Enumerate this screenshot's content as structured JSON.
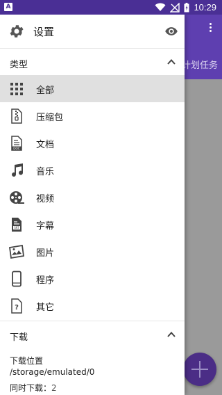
{
  "status_bar": {
    "time": "10:29",
    "notif_badge": "A"
  },
  "drawer": {
    "title": "设置",
    "types_section": {
      "title": "类型",
      "items": [
        {
          "label": "全部",
          "icon": "grid-icon",
          "selected": true
        },
        {
          "label": "压缩包",
          "icon": "archive-file-icon"
        },
        {
          "label": "文档",
          "icon": "doc-file-icon"
        },
        {
          "label": "音乐",
          "icon": "music-note-icon"
        },
        {
          "label": "视频",
          "icon": "film-reel-icon"
        },
        {
          "label": "字幕",
          "icon": "subtitle-file-icon"
        },
        {
          "label": "图片",
          "icon": "image-icon"
        },
        {
          "label": "程序",
          "icon": "phone-icon"
        },
        {
          "label": "其它",
          "icon": "unknown-file-icon"
        }
      ]
    },
    "download_section": {
      "title": "下载",
      "location_label": "下载位置",
      "location_value": "/storage/emulated/0",
      "concurrent_label": "同时下载：",
      "concurrent_value": "2"
    }
  },
  "background_app": {
    "task_text": "计划任务"
  },
  "colors": {
    "status_bar": "#4a2f95",
    "app_bar": "#5e3fb0",
    "fab": "#4b2d86",
    "selected_row": "#e0e0e0"
  }
}
